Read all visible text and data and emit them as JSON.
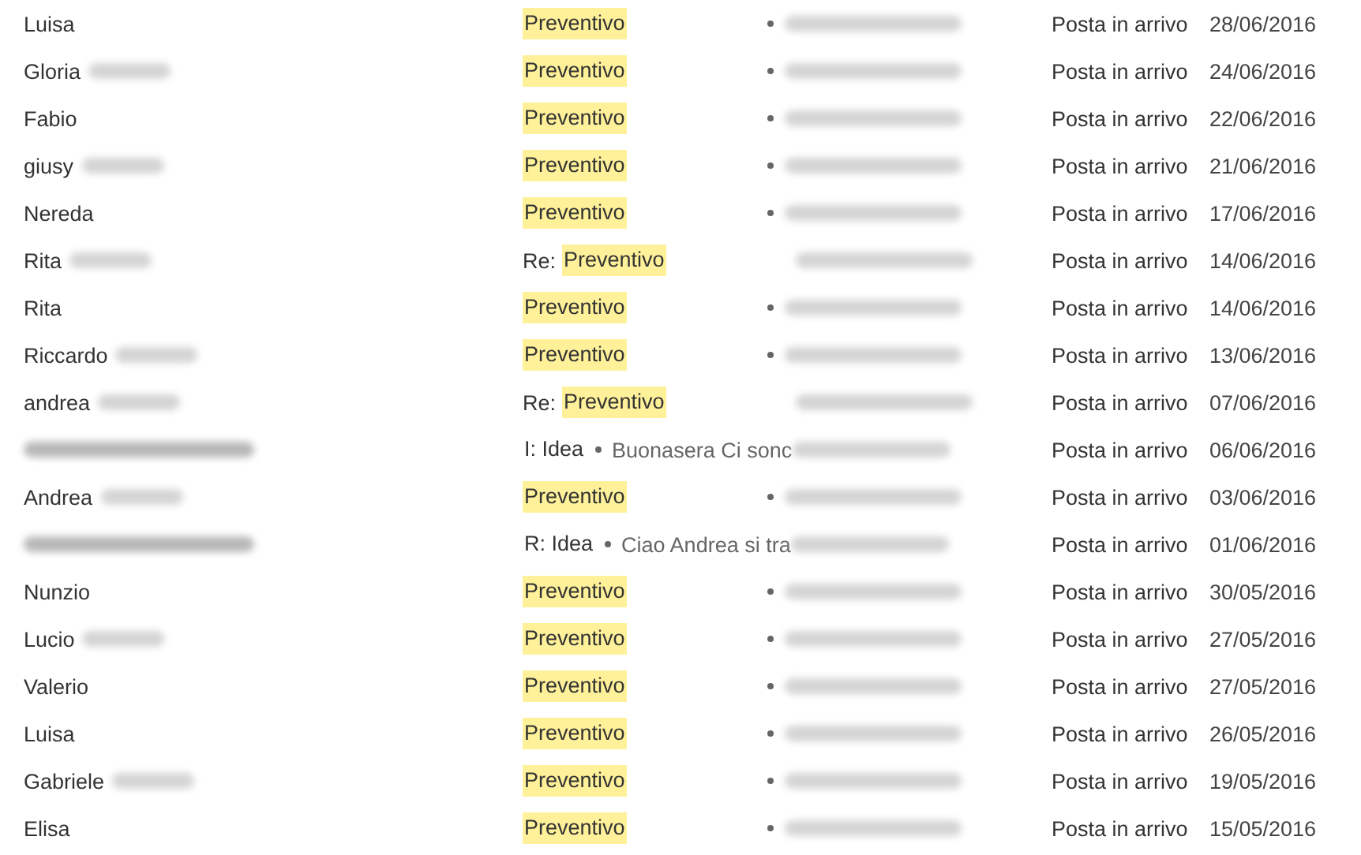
{
  "messages": [
    {
      "sender": "Luisa",
      "sender_blurred": false,
      "subject": "Preventivo",
      "highlighted": true,
      "bullet": true,
      "folder": "Posta in arrivo",
      "date": "28/06/2016"
    },
    {
      "sender": "Gloria",
      "sender_blurred": true,
      "subject": "Preventivo",
      "highlighted": true,
      "bullet": true,
      "folder": "Posta in arrivo",
      "date": "24/06/2016"
    },
    {
      "sender": "Fabio",
      "sender_blurred": false,
      "subject": "Preventivo",
      "highlighted": true,
      "bullet": true,
      "folder": "Posta in arrivo",
      "date": "22/06/2016"
    },
    {
      "sender": "giusy",
      "sender_blurred": true,
      "subject": "Preventivo",
      "highlighted": true,
      "bullet": true,
      "folder": "Posta in arrivo",
      "date": "21/06/2016"
    },
    {
      "sender": "Nereda",
      "sender_blurred": false,
      "subject": "Preventivo",
      "highlighted": true,
      "bullet": true,
      "folder": "Posta in arrivo",
      "date": "17/06/2016"
    },
    {
      "sender": "Rita",
      "sender_blurred": true,
      "subject_prefix": "Re:",
      "subject": "Preventivo",
      "highlighted": true,
      "bullet": false,
      "folder": "Posta in arrivo",
      "date": "14/06/2016"
    },
    {
      "sender": "Rita",
      "sender_blurred": false,
      "subject": "Preventivo",
      "highlighted": true,
      "bullet": true,
      "folder": "Posta in arrivo",
      "date": "14/06/2016"
    },
    {
      "sender": "Riccardo",
      "sender_blurred": true,
      "subject": "Preventivo",
      "highlighted": true,
      "bullet": true,
      "folder": "Posta in arrivo",
      "date": "13/06/2016"
    },
    {
      "sender": "andrea",
      "sender_blurred": true,
      "subject_prefix": "Re:",
      "subject": "Preventivo",
      "highlighted": true,
      "bullet": false,
      "folder": "Posta in arrivo",
      "date": "07/06/2016"
    },
    {
      "sender_blurred": true,
      "subject": "I: Idea",
      "highlighted": false,
      "bullet": true,
      "preview": "Buonasera Ci sonc",
      "folder": "Posta in arrivo",
      "date": "06/06/2016"
    },
    {
      "sender": "Andrea",
      "sender_blurred": true,
      "subject": "Preventivo",
      "highlighted": true,
      "bullet": true,
      "folder": "Posta in arrivo",
      "date": "03/06/2016"
    },
    {
      "sender_blurred": true,
      "subject": "R: Idea",
      "highlighted": false,
      "bullet": true,
      "preview": "Ciao Andrea si tra",
      "folder": "Posta in arrivo",
      "date": "01/06/2016"
    },
    {
      "sender": "Nunzio",
      "sender_blurred": false,
      "subject": "Preventivo",
      "highlighted": true,
      "bullet": true,
      "folder": "Posta in arrivo",
      "date": "30/05/2016"
    },
    {
      "sender": "Lucio",
      "sender_blurred": true,
      "subject": "Preventivo",
      "highlighted": true,
      "bullet": true,
      "folder": "Posta in arrivo",
      "date": "27/05/2016"
    },
    {
      "sender": "Valerio",
      "sender_blurred": false,
      "subject": "Preventivo",
      "highlighted": true,
      "bullet": true,
      "folder": "Posta in arrivo",
      "date": "27/05/2016"
    },
    {
      "sender": "Luisa",
      "sender_blurred": false,
      "subject": "Preventivo",
      "highlighted": true,
      "bullet": true,
      "folder": "Posta in arrivo",
      "date": "26/05/2016"
    },
    {
      "sender": "Gabriele",
      "sender_blurred": true,
      "subject": "Preventivo",
      "highlighted": true,
      "bullet": true,
      "folder": "Posta in arrivo",
      "date": "19/05/2016"
    },
    {
      "sender": "Elisa",
      "sender_blurred": false,
      "subject": "Preventivo",
      "highlighted": true,
      "bullet": true,
      "folder": "Posta in arrivo",
      "date": "15/05/2016"
    }
  ]
}
